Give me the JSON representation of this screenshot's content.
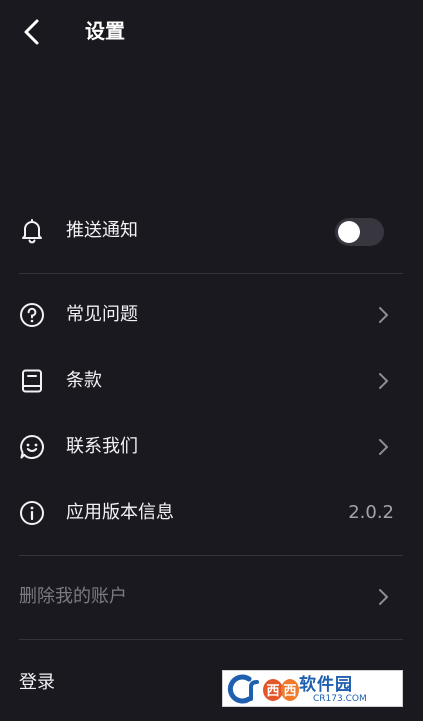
{
  "header": {
    "title": "设置",
    "back_icon": "chevron-left-icon"
  },
  "settings": {
    "push": {
      "label": "推送通知",
      "icon": "bell-icon",
      "enabled": false
    },
    "faq": {
      "label": "常见问题",
      "icon": "help-circle-icon"
    },
    "terms": {
      "label": "条款",
      "icon": "book-icon"
    },
    "contact": {
      "label": "联系我们",
      "icon": "chat-smile-icon"
    },
    "version": {
      "label": "应用版本信息",
      "icon": "info-icon",
      "value": "2.0.2"
    },
    "delete_account": {
      "label": "删除我的账户"
    },
    "login": {
      "label": "登录"
    }
  },
  "watermark": {
    "main": "软件园",
    "sub": "CR173.COM"
  },
  "colors": {
    "background": "#1a191f",
    "text": "#f2f2f4",
    "muted_text": "#7b7a83",
    "value_text": "#a4a3ab",
    "divider": "#34333a",
    "toggle_track": "#38373f"
  }
}
